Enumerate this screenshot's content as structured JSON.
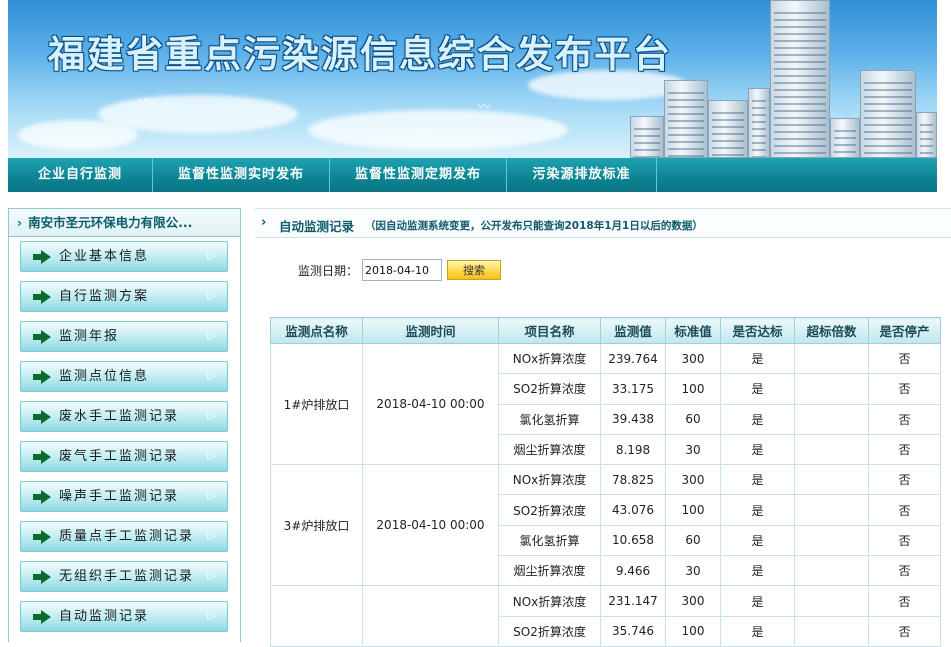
{
  "banner": {
    "title": "福建省重点污染源信息综合发布平台"
  },
  "nav": [
    "企业自行监测",
    "监督性监测实时发布",
    "监督性监测定期发布",
    "污染源排放标准"
  ],
  "sidebar": {
    "company": "南安市圣元环保电力有限公...",
    "items": [
      "企业基本信息",
      "自行监测方案",
      "监测年报",
      "监测点位信息",
      "废水手工监测记录",
      "废气手工监测记录",
      "噪声手工监测记录",
      "质量点手工监测记录",
      "无组织手工监测记录",
      "自动监测记录"
    ]
  },
  "main": {
    "title": "自动监测记录",
    "note": "（因自动监测系统变更，公开发布只能查询2018年1月1日以后的数据）",
    "date_label": "监测日期：",
    "date_value": "2018-04-10",
    "search_label": "搜索"
  },
  "table": {
    "headers": [
      "监测点名称",
      "监测时间",
      "项目名称",
      "监测值",
      "标准值",
      "是否达标",
      "超标倍数",
      "是否停产"
    ],
    "groups": [
      {
        "point": "1#炉排放口",
        "time": "2018-04-10 00:00",
        "rows": [
          [
            "NOx折算浓度",
            "239.764",
            "300",
            "是",
            "",
            "否"
          ],
          [
            "SO2折算浓度",
            "33.175",
            "100",
            "是",
            "",
            "否"
          ],
          [
            "氯化氢折算",
            "39.438",
            "60",
            "是",
            "",
            "否"
          ],
          [
            "烟尘折算浓度",
            "8.198",
            "30",
            "是",
            "",
            "否"
          ]
        ]
      },
      {
        "point": "3#炉排放口",
        "time": "2018-04-10 00:00",
        "rows": [
          [
            "NOx折算浓度",
            "78.825",
            "300",
            "是",
            "",
            "否"
          ],
          [
            "SO2折算浓度",
            "43.076",
            "100",
            "是",
            "",
            "否"
          ],
          [
            "氯化氢折算",
            "10.658",
            "60",
            "是",
            "",
            "否"
          ],
          [
            "烟尘折算浓度",
            "9.466",
            "30",
            "是",
            "",
            "否"
          ]
        ]
      },
      {
        "point": "",
        "time": "",
        "rows": [
          [
            "NOx折算浓度",
            "231.147",
            "300",
            "是",
            "",
            "否"
          ],
          [
            "SO2折算浓度",
            "35.746",
            "100",
            "是",
            "",
            "否"
          ]
        ]
      }
    ]
  }
}
